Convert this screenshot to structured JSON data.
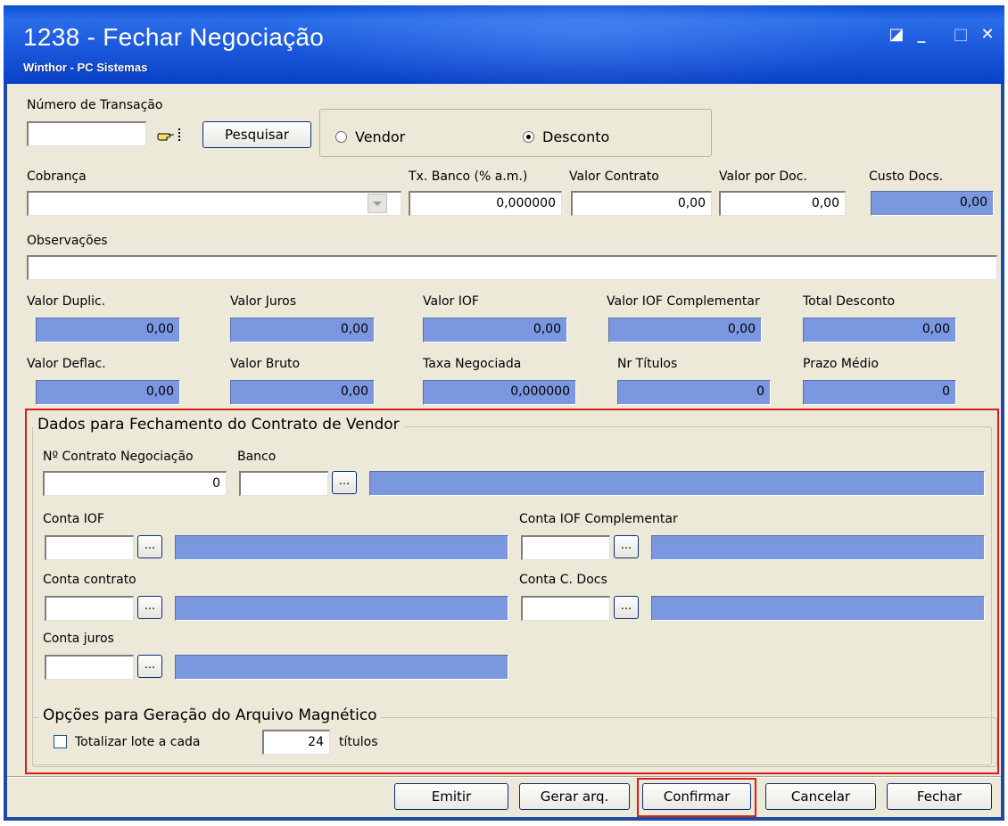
{
  "window": {
    "title": "1238 - Fechar Negociação",
    "subtitle": "Winthor - PC Sistemas",
    "controls": [
      "◪",
      "_",
      "□",
      "✕"
    ]
  },
  "transacao": {
    "label": "Número de Transação",
    "value": "",
    "search_button": "Pesquisar"
  },
  "tipo": {
    "options": [
      "Vendor",
      "Desconto"
    ],
    "selected": "Desconto"
  },
  "cobranca": {
    "label": "Cobrança",
    "value": ""
  },
  "tx_banco": {
    "label": "Tx. Banco (% a.m.)",
    "value": "0,000000"
  },
  "valor_contrato": {
    "label": "Valor Contrato",
    "value": "0,00"
  },
  "valor_por_doc": {
    "label": "Valor por Doc.",
    "value": "0,00"
  },
  "custo_docs": {
    "label": "Custo Docs.",
    "value": "0,00"
  },
  "observacoes": {
    "label": "Observações",
    "value": ""
  },
  "totais": {
    "valor_duplic": {
      "label": "Valor Duplic.",
      "value": "0,00"
    },
    "valor_juros": {
      "label": "Valor Juros",
      "value": "0,00"
    },
    "valor_iof": {
      "label": "Valor IOF",
      "value": "0,00"
    },
    "valor_iof_comp": {
      "label": "Valor IOF Complementar",
      "value": "0,00"
    },
    "total_desconto": {
      "label": "Total Desconto",
      "value": "0,00"
    },
    "valor_deflac": {
      "label": "Valor Deflac.",
      "value": "0,00"
    },
    "valor_bruto": {
      "label": "Valor Bruto",
      "value": "0,00"
    },
    "taxa_negociada": {
      "label": "Taxa Negociada",
      "value": "0,000000"
    },
    "nr_titulos": {
      "label": "Nr Títulos",
      "value": "0"
    },
    "prazo_medio": {
      "label": "Prazo Médio",
      "value": "0"
    }
  },
  "vendor": {
    "group_title": "Dados para Fechamento do Contrato de Vendor",
    "nr_contrato": {
      "label": "Nº Contrato Negociação",
      "value": "0"
    },
    "banco": {
      "label": "Banco",
      "value": ""
    },
    "conta_iof": {
      "label": "Conta IOF",
      "value": ""
    },
    "conta_iof_comp": {
      "label": "Conta IOF Complementar",
      "value": ""
    },
    "conta_contrato": {
      "label": "Conta contrato",
      "value": ""
    },
    "conta_cdocs": {
      "label": "Conta C. Docs",
      "value": ""
    },
    "conta_juros": {
      "label": "Conta juros",
      "value": ""
    },
    "lookup_label": "..."
  },
  "magnetico": {
    "group_title": "Opções para Geração do Arquivo Magnético",
    "totalizar_label": "Totalizar lote a cada",
    "totalizar_checked": false,
    "lote_value": "24",
    "suffix": "títulos"
  },
  "buttons": {
    "emitir": "Emitir",
    "gerar": "Gerar arq.",
    "confirmar": "Confirmar",
    "cancelar": "Cancelar",
    "fechar": "Fechar"
  },
  "colors": {
    "readonly_field": "#7b97e0",
    "highlight": "#e01b1b",
    "title_bar": "#1a58dc",
    "panel": "#ece9d8"
  }
}
